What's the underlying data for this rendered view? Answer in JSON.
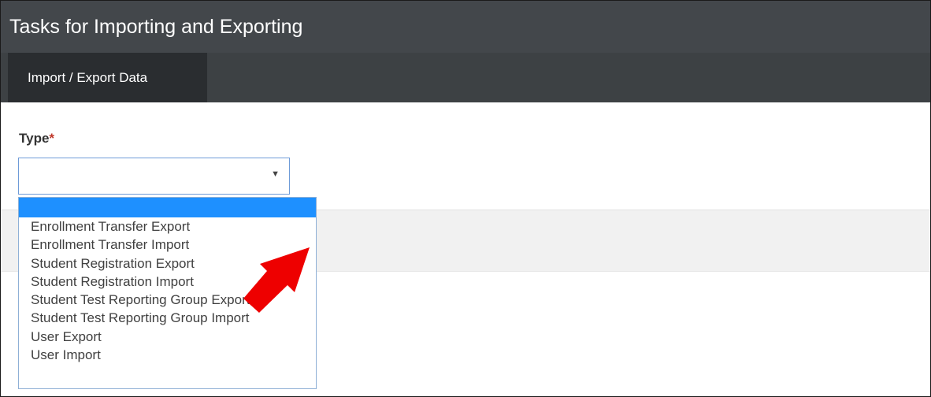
{
  "header": {
    "title": "Tasks for Importing and Exporting"
  },
  "tabs": [
    {
      "label": "Import / Export Data"
    }
  ],
  "form": {
    "type_label": "Type",
    "required_marker": "*",
    "select_value": "",
    "options": [
      "Enrollment Transfer Export",
      "Enrollment Transfer Import",
      "Student Registration Export",
      "Student Registration Import",
      "Student Test Reporting Group Export",
      "Student Test Reporting Group Import",
      "User Export",
      "User Import"
    ]
  },
  "annotation": {
    "color": "#ee0000",
    "points_to": "Student Registration Import"
  },
  "colors": {
    "title_bar": "#43474b",
    "tab_bar": "#3d4144",
    "active_tab": "#2a2d30",
    "highlight": "#1e90ff"
  }
}
